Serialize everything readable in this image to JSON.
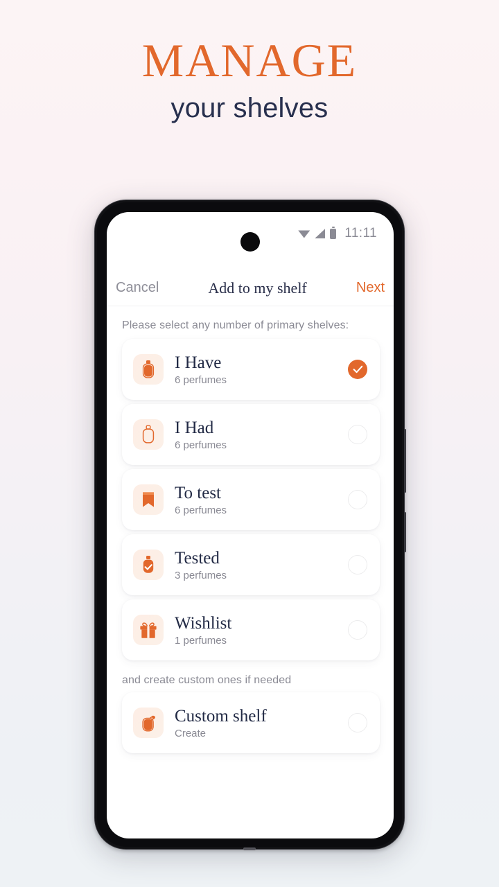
{
  "hero": {
    "title": "MANAGE",
    "subtitle": "your shelves",
    "title_color": "#e2682c",
    "subtitle_color": "#28304e"
  },
  "phone": {
    "status_bar": {
      "time": "11:11",
      "icons": [
        "wifi-icon",
        "signal-icon",
        "battery-icon"
      ]
    },
    "navbar": {
      "cancel_label": "Cancel",
      "title": "Add to my shelf",
      "next_label": "Next",
      "next_color": "#e2682c"
    },
    "primary_section_label": "Please select any number of primary shelves:",
    "custom_section_label": "and create custom ones if needed",
    "accent_color": "#e2682c",
    "shelves": [
      {
        "name": "I Have",
        "count": "6 perfumes",
        "icon": "perfume-bottle-filled-icon",
        "selected": true
      },
      {
        "name": "I Had",
        "count": "6 perfumes",
        "icon": "perfume-bottle-outline-icon",
        "selected": false
      },
      {
        "name": "To test",
        "count": "6 perfumes",
        "icon": "bookmark-icon",
        "selected": false
      },
      {
        "name": "Tested",
        "count": "3 perfumes",
        "icon": "perfume-bottle-check-icon",
        "selected": false
      },
      {
        "name": "Wishlist",
        "count": "1 perfumes",
        "icon": "gift-icon",
        "selected": false
      }
    ],
    "custom_shelf": {
      "name": "Custom shelf",
      "action": "Create",
      "icon": "perfume-atomizer-icon",
      "selected": false
    }
  }
}
